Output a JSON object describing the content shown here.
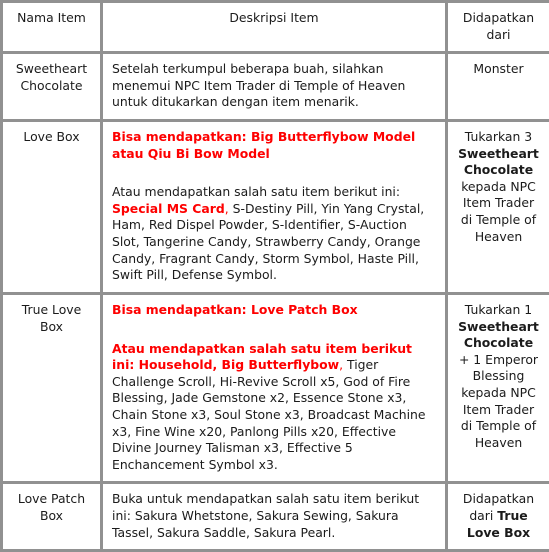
{
  "table": {
    "headers": {
      "name": "Nama Item",
      "description": "Deskripsi Item",
      "source": "Didapatkan dari"
    },
    "rows": [
      {
        "id": "sweetheart-chocolate",
        "name": "Sweetheart Chocolate",
        "description": {
          "paragraphs": [
            {
              "segments": [
                {
                  "text": "Setelah terkumpul beberapa buah, silahkan menemui NPC Item Trader di Temple of Heaven untuk ditukarkan dengan item menarik.",
                  "style": "normal"
                }
              ]
            }
          ]
        },
        "source": {
          "segments": [
            {
              "text": "Monster",
              "style": "normal"
            }
          ]
        }
      },
      {
        "id": "love-box",
        "name": "Love Box",
        "description": {
          "paragraphs": [
            {
              "segments": [
                {
                  "text": "Bisa mendapatkan: Big Butterflybow Model atau Qiu Bi Bow Model",
                  "style": "red-bold"
                }
              ]
            },
            {
              "gap": true,
              "segments": [
                {
                  "text": "Atau mendapatkan salah satu item berikut ini: ",
                  "style": "normal"
                },
                {
                  "text": "Special MS Card",
                  "style": "red-bold"
                },
                {
                  "text": ", ",
                  "style": "red"
                },
                {
                  "text": "S-Destiny Pill, Yin Yang Crystal, Ham, Red Dispel Powder, S-Identifier, S-Auction Slot, Tangerine Candy, Strawberry Candy, Orange Candy, Fragrant Candy, Storm Symbol, Haste Pill, Swift Pill, Defense Symbol.",
                  "style": "normal"
                }
              ]
            }
          ]
        },
        "source": {
          "segments": [
            {
              "text": "Tukarkan 3 ",
              "style": "normal"
            },
            {
              "text": "Sweetheart Chocolate",
              "style": "bold"
            },
            {
              "text": " kepada NPC Item Trader di Temple of Heaven",
              "style": "normal"
            }
          ]
        }
      },
      {
        "id": "true-love-box",
        "name": "True Love Box",
        "description": {
          "paragraphs": [
            {
              "segments": [
                {
                  "text": "Bisa mendapatkan: Love Patch Box",
                  "style": "red-bold"
                }
              ]
            },
            {
              "gap": true,
              "segments": [
                {
                  "text": "Atau mendapatkan salah satu item berikut ini: Household, Big Butterflybow",
                  "style": "red-bold"
                },
                {
                  "text": ", ",
                  "style": "red"
                },
                {
                  "text": "Tiger Challenge Scroll, Hi-Revive Scroll x5, God of Fire Blessing, Jade Gemstone x2, Essence Stone x3, Chain Stone x3, Soul Stone x3, Broadcast Machine x3, Fine Wine x20, Panlong Pills x20, Effective Divine Journey Talisman x3, Effective 5 Enchancement Symbol x3.",
                  "style": "normal"
                }
              ]
            }
          ]
        },
        "source": {
          "segments": [
            {
              "text": "Tukarkan 1 ",
              "style": "normal"
            },
            {
              "text": "Sweetheart Chocolate",
              "style": "bold"
            },
            {
              "text": " + 1 Emperor Blessing kepada NPC Item Trader di Temple of Heaven",
              "style": "normal"
            }
          ]
        }
      },
      {
        "id": "love-patch-box",
        "name": "Love Patch Box",
        "description": {
          "paragraphs": [
            {
              "segments": [
                {
                  "text": "Buka untuk mendapatkan salah satu item berikut ini: Sakura Whetstone, Sakura Sewing, Sakura Tassel, Sakura Saddle, Sakura Pearl.",
                  "style": "normal"
                }
              ]
            }
          ]
        },
        "source": {
          "segments": [
            {
              "text": "Didapatkan dari ",
              "style": "normal"
            },
            {
              "text": "True Love Box",
              "style": "bold"
            }
          ]
        }
      }
    ]
  },
  "colors": {
    "border": "#919191",
    "text": "#1b1b1b",
    "highlight_red": "#fe0000",
    "background": "#ffffff"
  }
}
